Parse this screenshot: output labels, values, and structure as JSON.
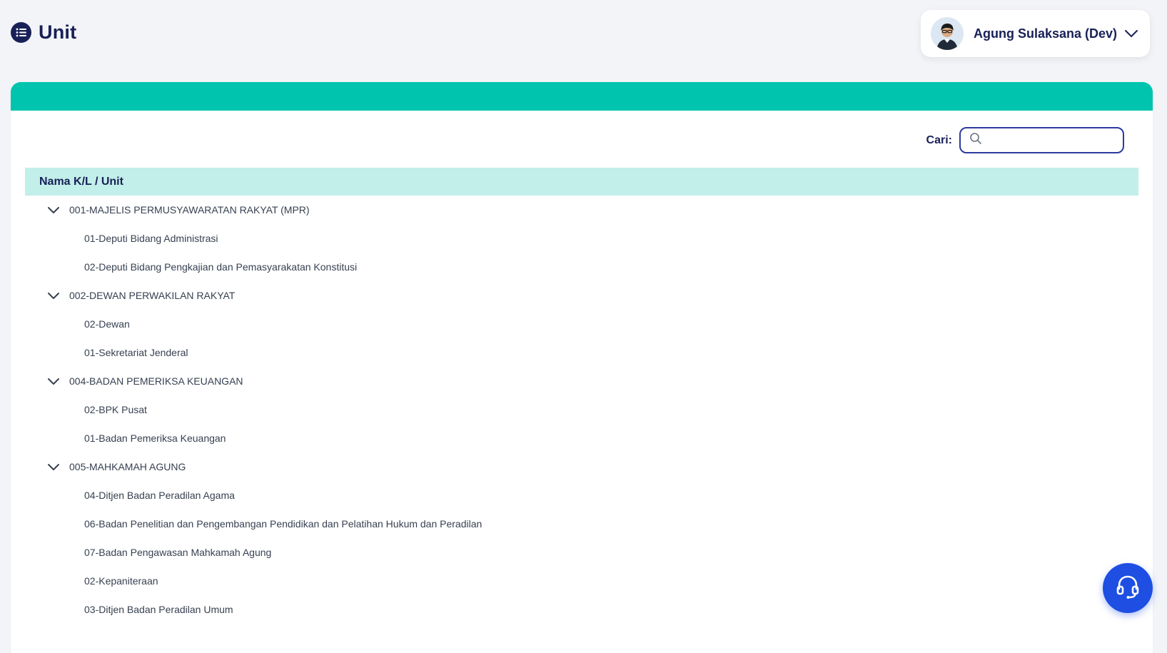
{
  "header": {
    "title": "Unit",
    "title_icon": "list-icon"
  },
  "user": {
    "name": "Agung Sulaksana (Dev)",
    "avatar_icon": "user-avatar",
    "dropdown_icon": "chevron-down-icon"
  },
  "search": {
    "label": "Cari:",
    "value": "",
    "placeholder": "",
    "icon": "search-icon"
  },
  "table": {
    "column_header": "Nama K/L / Unit",
    "rows": [
      {
        "type": "parent",
        "label": "001-MAJELIS PERMUSYAWARATAN RAKYAT (MPR)",
        "expanded": true
      },
      {
        "type": "child",
        "label": "01-Deputi Bidang Administrasi"
      },
      {
        "type": "child",
        "label": "02-Deputi Bidang Pengkajian dan Pemasyarakatan Konstitusi"
      },
      {
        "type": "parent",
        "label": "002-DEWAN PERWAKILAN RAKYAT",
        "expanded": true
      },
      {
        "type": "child",
        "label": "02-Dewan"
      },
      {
        "type": "child",
        "label": "01-Sekretariat Jenderal"
      },
      {
        "type": "parent",
        "label": "004-BADAN PEMERIKSA KEUANGAN",
        "expanded": true
      },
      {
        "type": "child",
        "label": "02-BPK Pusat"
      },
      {
        "type": "child",
        "label": "01-Badan Pemeriksa Keuangan"
      },
      {
        "type": "parent",
        "label": "005-MAHKAMAH AGUNG",
        "expanded": true
      },
      {
        "type": "child",
        "label": "04-Ditjen Badan Peradilan Agama"
      },
      {
        "type": "child",
        "label": "06-Badan Penelitian dan Pengembangan Pendidikan dan Pelatihan Hukum dan Peradilan"
      },
      {
        "type": "child",
        "label": "07-Badan Pengawasan Mahkamah Agung"
      },
      {
        "type": "child",
        "label": "02-Kepaniteraan"
      },
      {
        "type": "child",
        "label": "03-Ditjen Badan Peradilan Umum"
      }
    ]
  },
  "help_button": {
    "icon": "headset-icon"
  },
  "colors": {
    "navy": "#182057",
    "teal": "#00c4ae",
    "header_row": "#c2efe9",
    "help_blue": "#1e4ee2",
    "background": "#f3f4f8"
  }
}
